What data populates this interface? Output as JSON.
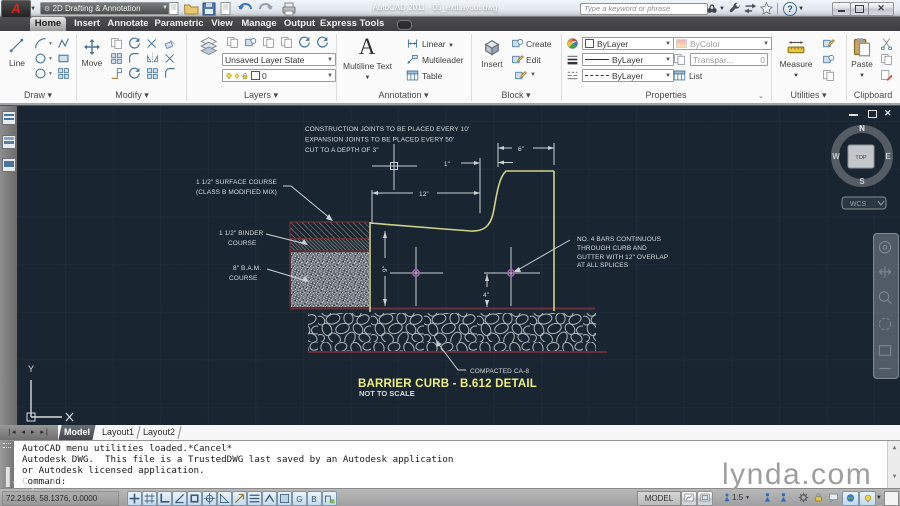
{
  "title_bar": {
    "logo": "A",
    "workspace": "2D Drafting & Annotation",
    "title": "AutoCAD 2011 - 05_extLayout.dwg",
    "search_placeholder": "Type a keyword or phrase"
  },
  "tabs": {
    "home": "Home",
    "insert": "Insert",
    "annotate": "Annotate",
    "parametric": "Parametric",
    "view": "View",
    "manage": "Manage",
    "output": "Output",
    "express": "Express Tools"
  },
  "ribbon": {
    "draw": {
      "label": "Draw",
      "line": "Line"
    },
    "modify": {
      "label": "Modify",
      "move": "Move"
    },
    "layers": {
      "label": "Layers",
      "state": "Unsaved Layer State",
      "layer": "0"
    },
    "annotation": {
      "label": "Annotation",
      "mtext": "Multiline Text",
      "linear": "Linear",
      "multileader": "Multileader",
      "table": "Table"
    },
    "block": {
      "label": "Block",
      "insert": "Insert",
      "create": "Create",
      "edit": "Edit"
    },
    "properties": {
      "label": "Properties",
      "color": "ByLayer",
      "lineweight": "ByLayer",
      "linetype": "ByLayer",
      "bycolor": "ByColor",
      "transparency": "Transpar...",
      "transparency_value": "0",
      "list": "List"
    },
    "utilities": {
      "label": "Utilities",
      "measure": "Measure"
    },
    "clipboard": {
      "label": "Clipboard",
      "paste": "Paste"
    }
  },
  "viewcube": {
    "n": "N",
    "s": "S",
    "e": "E",
    "w": "W",
    "top": "TOP",
    "wcs": "WCS"
  },
  "drawing": {
    "notes_top": [
      "CONSTRUCTION JOINTS TO BE PLACED EVERY 10'",
      "EXPANSION JOINTS TO BE PLACED EVERY 50'",
      "CUT TO A DEPTH OF 3\""
    ],
    "label_surface1": "1 1/2\" SURFACE COURSE",
    "label_surface2": "(CLASS B MODIFIED MIX)",
    "label_binder1": "1 1/2\" BINDER",
    "label_binder2": "COURSE",
    "label_bam1": "8\" B.A.M.",
    "label_bam2": "COURSE",
    "label_bars1": "NO. 4 BARS CONTINUOUS",
    "label_bars2": "THROUGH CURB AND",
    "label_bars3": "GUTTER WITH 12\" OVERLAP",
    "label_bars4": "AT ALL SPLICES",
    "label_compacted": "COMPACTED CA-8",
    "dim_6": "6\"",
    "dim_1": "1\"",
    "dim_12": "12\"",
    "dim_9": "9\"",
    "dim_4": "4\"",
    "title": "BARRIER CURB - B.612 DETAIL",
    "subtitle": "NOT TO SCALE",
    "ucs_x": "X",
    "ucs_y": "Y"
  },
  "layout_tabs": {
    "model": "Model",
    "layout1": "Layout1",
    "layout2": "Layout2"
  },
  "command": {
    "line1": "AutoCAD menu utilities loaded.*Cancel*",
    "line2": "Autodesk DWG.  This file is a TrustedDWG last saved by an Autodesk application",
    "line3": "or Autodesk licensed application.",
    "prompt": "Command:"
  },
  "status": {
    "coords": "72.2168, 58.1376, 0.0000",
    "model": "MODEL",
    "scale": "1:5"
  },
  "watermark": {
    "full": "lynda.com",
    "partial": "la"
  }
}
